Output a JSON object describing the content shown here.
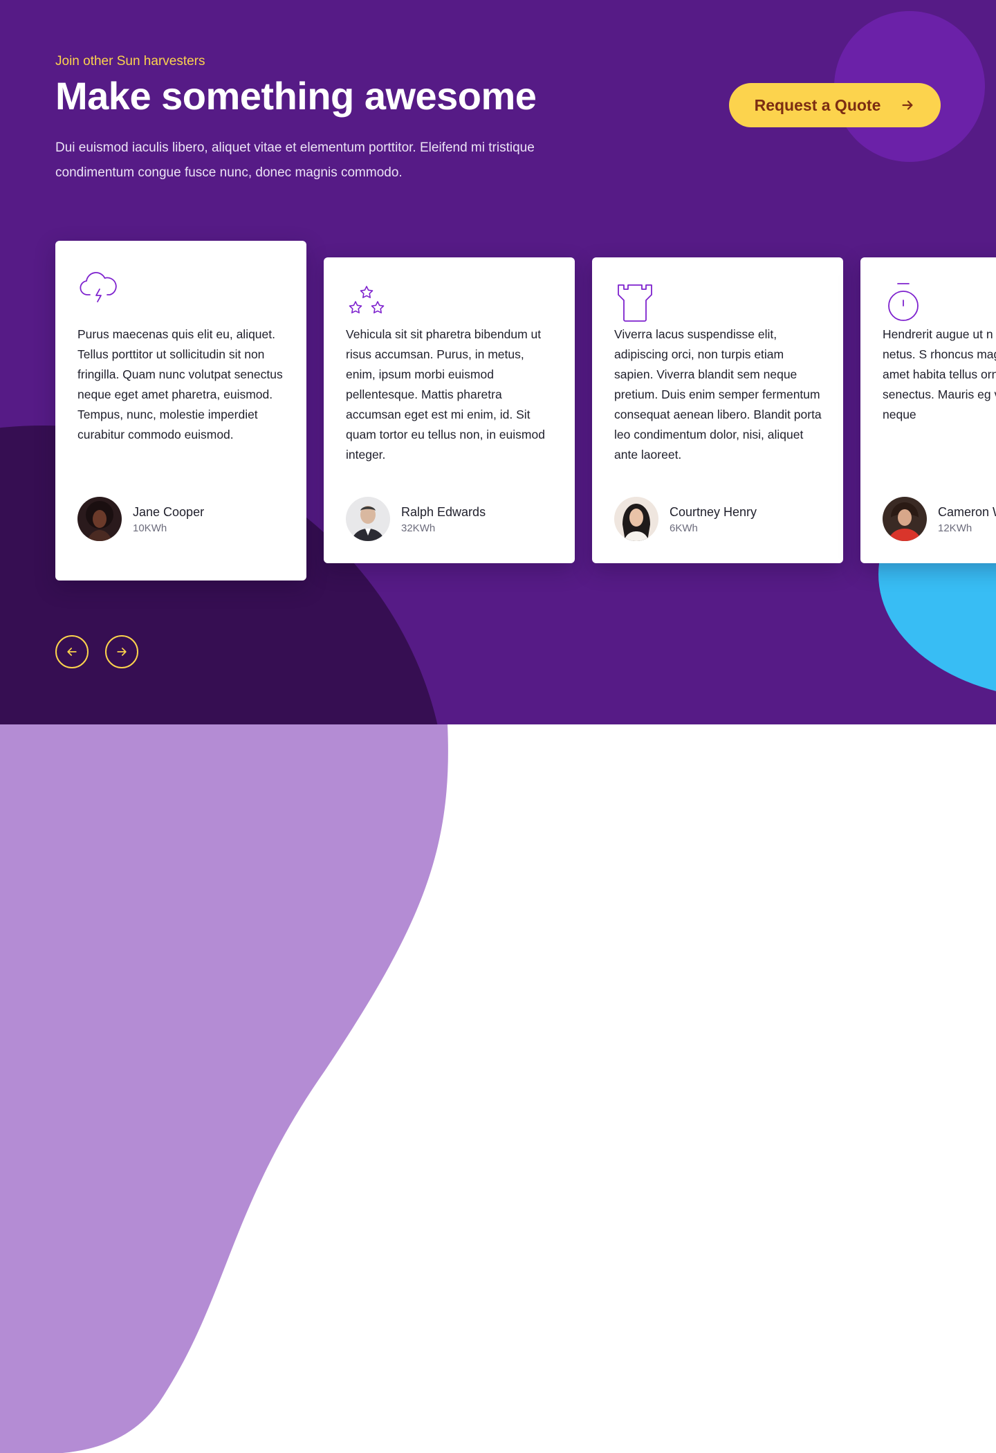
{
  "colors": {
    "hero_bg": "#561b86",
    "accent_yellow": "#fcd34d",
    "dark_blob": "#360e52",
    "blue_blob": "#38bdf4",
    "lilac_blob": "#b48cd4",
    "icon_purple": "#7e22ce"
  },
  "hero": {
    "eyebrow": "Join other Sun harvesters",
    "title": "Make something awesome",
    "intro": "Dui euismod iaculis libero, aliquet vitae et elementum porttitor. Eleifend mi tristique condimentum congue fusce nunc, donec magnis commodo.",
    "cta": {
      "label": "Request a Quote",
      "icon": "arrow-right-icon"
    }
  },
  "testimonials": [
    {
      "icon": "cloud-lightning-icon",
      "text": "Purus maecenas quis elit eu, aliquet. Tellus porttitor ut sollicitudin sit non fringilla. Quam nunc volutpat senectus neque eget amet pharetra, euismod. Tempus, nunc, molestie imperdiet curabitur commodo euismod.",
      "name": "Jane Cooper",
      "energy": "10KWh"
    },
    {
      "icon": "stars-icon",
      "text": "Vehicula sit sit pharetra bibendum ut risus accumsan. Purus, in metus, enim, ipsum morbi euismod pellentesque. Mattis pharetra accumsan eget est mi enim, id. Sit quam tortor eu tellus non, in euismod integer.",
      "name": "Ralph Edwards",
      "energy": "32KWh"
    },
    {
      "icon": "tower-icon",
      "text": "Viverra lacus suspendisse elit, adipiscing orci, non turpis etiam sapien. Viverra blandit sem neque pretium. Duis enim semper fermentum consequat aenean libero. Blandit porta leo condimentum dolor, nisi, aliquet ante laoreet.",
      "name": "Courtney Henry",
      "energy": "6KWh"
    },
    {
      "icon": "stopwatch-icon",
      "text": "Hendrerit augue ut n quis integer netus. S rhoncus magnis hab Egestas amet habita tellus ornare. Hendre senectus. Mauris eg vitae praesent neque",
      "name": "Cameron W",
      "energy": "12KWh"
    }
  ],
  "carousel": {
    "prev_icon": "arrow-left-icon",
    "next_icon": "arrow-right-icon"
  }
}
